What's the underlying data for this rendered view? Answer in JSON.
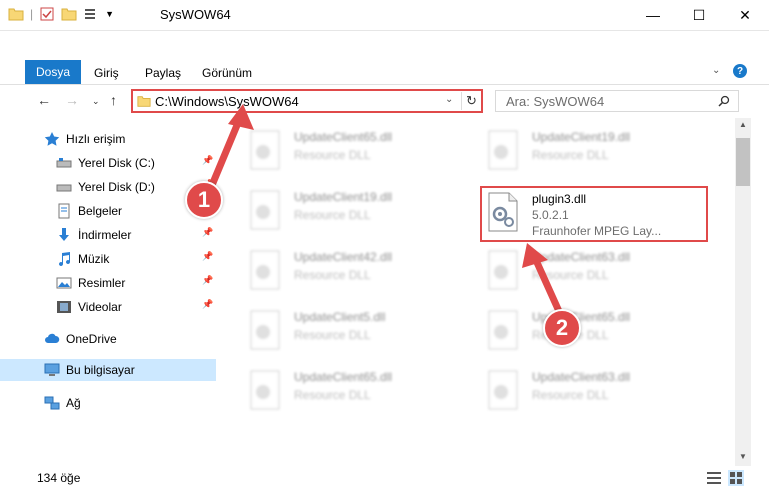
{
  "window": {
    "title": "SysWOW64"
  },
  "ribbon": {
    "tabs": [
      "Dosya",
      "Giriş",
      "Paylaş",
      "Görünüm"
    ]
  },
  "address": {
    "path": "C:\\Windows\\SysWOW64"
  },
  "search": {
    "placeholder": "Ara: SysWOW64"
  },
  "sidebar": {
    "items": [
      {
        "label": "Hızlı erişim",
        "icon": "star-icon",
        "pinned": false
      },
      {
        "label": "Yerel Disk (C:)",
        "icon": "drive-icon",
        "pinned": true
      },
      {
        "label": "Yerel Disk (D:)",
        "icon": "drive-icon",
        "pinned": true
      },
      {
        "label": "Belgeler",
        "icon": "documents-icon",
        "pinned": true
      },
      {
        "label": "İndirmeler",
        "icon": "download-icon",
        "pinned": true
      },
      {
        "label": "Müzik",
        "icon": "music-icon",
        "pinned": true
      },
      {
        "label": "Resimler",
        "icon": "pictures-icon",
        "pinned": true
      },
      {
        "label": "Videolar",
        "icon": "video-icon",
        "pinned": true
      },
      {
        "label": "OneDrive",
        "icon": "cloud-icon",
        "pinned": false
      },
      {
        "label": "Bu bilgisayar",
        "icon": "computer-icon",
        "pinned": false
      },
      {
        "label": "Ağ",
        "icon": "network-icon",
        "pinned": false
      }
    ]
  },
  "files": {
    "left": [
      {
        "name": "UpdateClient65.dll",
        "sub": "Resource DLL"
      },
      {
        "name": "UpdateClient19.dll",
        "sub": "Resource DLL"
      },
      {
        "name": "UpdateClient42.dll",
        "sub": "Resource DLL"
      },
      {
        "name": "UpdateClient5.dll",
        "sub": "Resource DLL"
      },
      {
        "name": "UpdateClient65.dll",
        "sub": "Resource DLL"
      }
    ],
    "right": [
      {
        "name": "UpdateClient19.dll",
        "sub": "Resource DLL"
      },
      {
        "name": "UpdateClient63.dll",
        "sub": "Resource DLL"
      },
      {
        "name": "UpdateClient65.dll",
        "sub": "Resource DLL"
      },
      {
        "name": "UpdateClient63.dll",
        "sub": "Resource DLL"
      }
    ],
    "highlighted": {
      "name": "plugin3.dll",
      "version": "5.0.2.1",
      "description": "Fraunhofer MPEG Lay..."
    }
  },
  "status": {
    "count": "134 öğe"
  },
  "callouts": [
    "1",
    "2"
  ]
}
